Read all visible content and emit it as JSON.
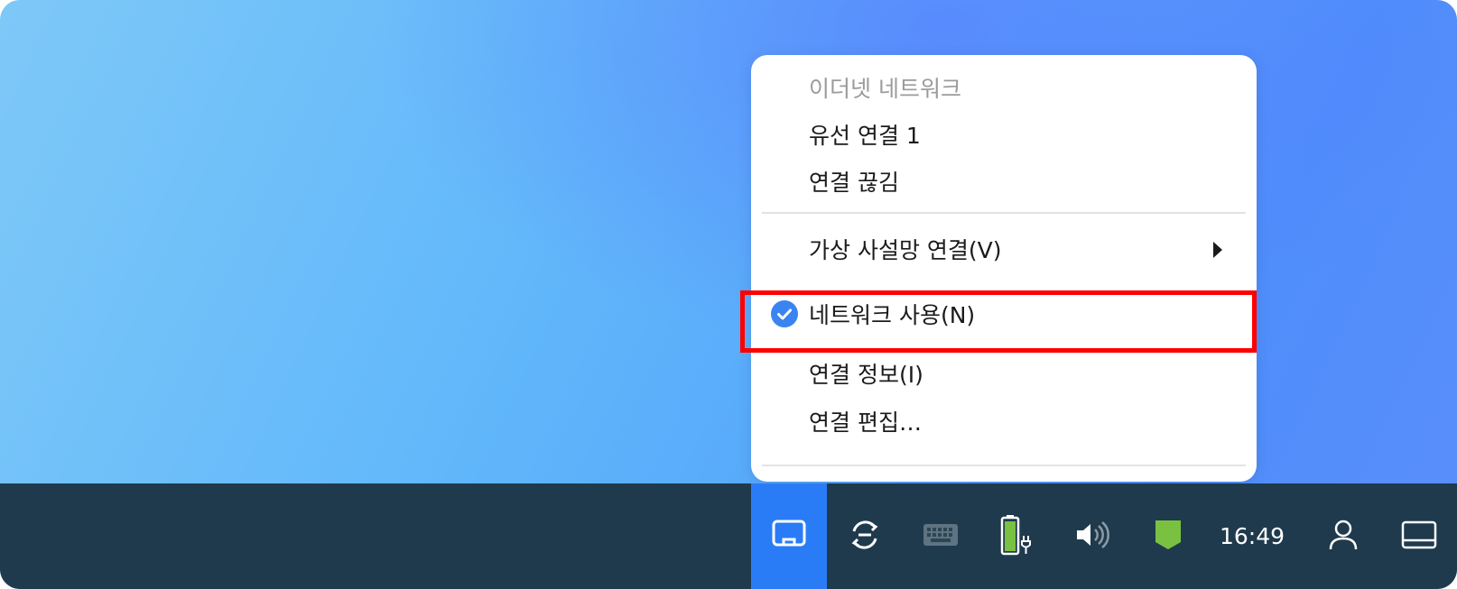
{
  "network_menu": {
    "items": [
      {
        "label": "이더넷 네트워크",
        "disabled": true
      },
      {
        "label": "유선 연결 1"
      },
      {
        "label": "연결 끊김"
      },
      {
        "label": "가상 사설망 연결(V)",
        "submenu": true
      },
      {
        "label": "네트워크 사용(N)",
        "checked": true
      },
      {
        "label": "연결 정보(I)"
      },
      {
        "label": "연결 편집…"
      }
    ]
  },
  "taskbar": {
    "tray_icons": [
      "network-icon",
      "sync-icon",
      "keyboard-icon",
      "battery-charging-icon",
      "volume-icon",
      "shield-icon"
    ],
    "clock": "16:49",
    "user_icon": "user-icon",
    "show_desktop_icon": "show-desktop-icon"
  },
  "colors": {
    "accent": "#2a7cf6",
    "taskbar": "#1f3a4d",
    "highlight_box": "#ff0000",
    "shield": "#7ac142"
  }
}
